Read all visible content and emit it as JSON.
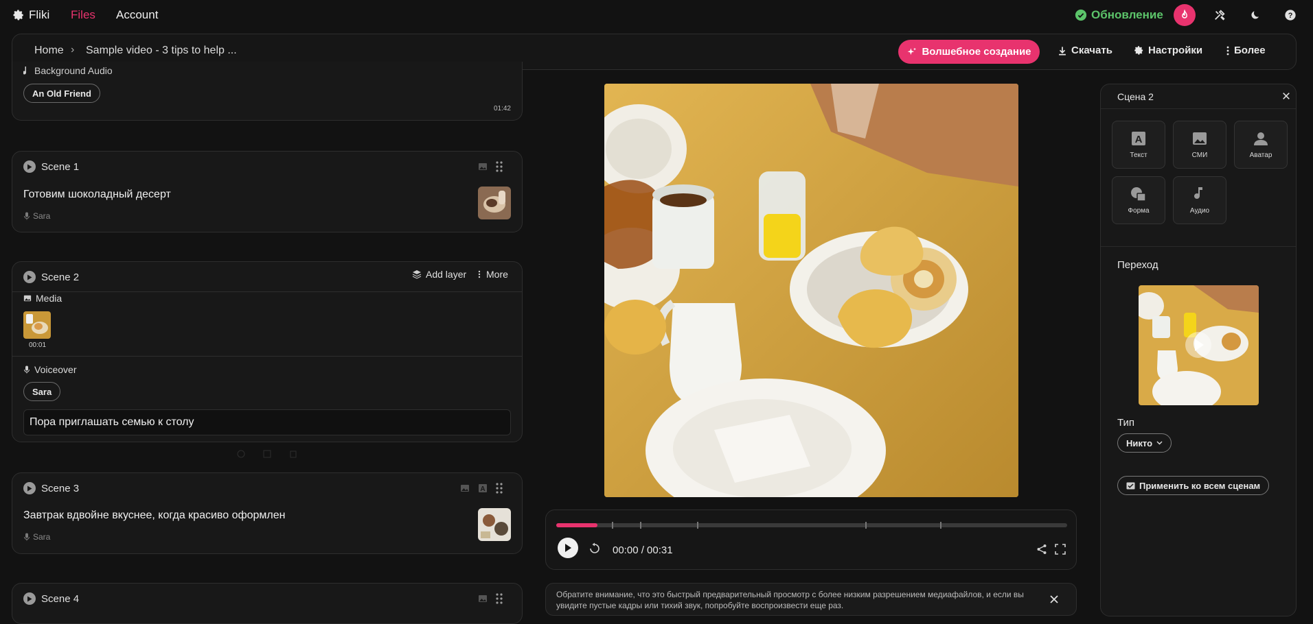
{
  "nav": {
    "brand": "Fliki",
    "files": "Files",
    "account": "Account",
    "update": "Обновление",
    "accent": "#e8336e"
  },
  "breadcrumb": {
    "home": "Home",
    "sep": "›",
    "current": "Sample video - 3 tips to help ..."
  },
  "toolbar": {
    "magic": "Волшебное создание",
    "download": "Скачать",
    "settings": "Настройки",
    "more": "Более"
  },
  "audio": {
    "label": "Background Audio",
    "track": "An Old Friend",
    "duration": "01:42"
  },
  "scenes": [
    {
      "title": "Scene 1",
      "text": "Готовим шоколадный десерт",
      "voice": "Sara"
    },
    {
      "title": "Scene 2",
      "add_layer": "Add layer",
      "more": "More",
      "media_label": "Media",
      "media_time": "00:01",
      "voiceover_label": "Voiceover",
      "voice": "Sara",
      "text": "Пора приглашать семью к столу"
    },
    {
      "title": "Scene 3",
      "text": "Завтрак вдвойне вкуснее, когда красиво оформлен",
      "voice": "Sara"
    },
    {
      "title": "Scene 4"
    }
  ],
  "player": {
    "time": "00:00 / 00:31",
    "progress": 0.08
  },
  "notice": {
    "text_line1": "Обратите внимание, что это быстрый предварительный просмотр с более низким разрешением медиафайлов, и если вы",
    "text_line2": "увидите пустые кадры или тихий звук, попробуйте воспроизвести еще раз."
  },
  "panel": {
    "title": "Сцена 2",
    "tools": [
      "Текст",
      "СМИ",
      "Аватар",
      "Форма",
      "Аудио"
    ],
    "transition_label": "Переход",
    "type_label": "Тип",
    "type_value": "Никто",
    "apply_all": "Применить ко всем сценам"
  }
}
